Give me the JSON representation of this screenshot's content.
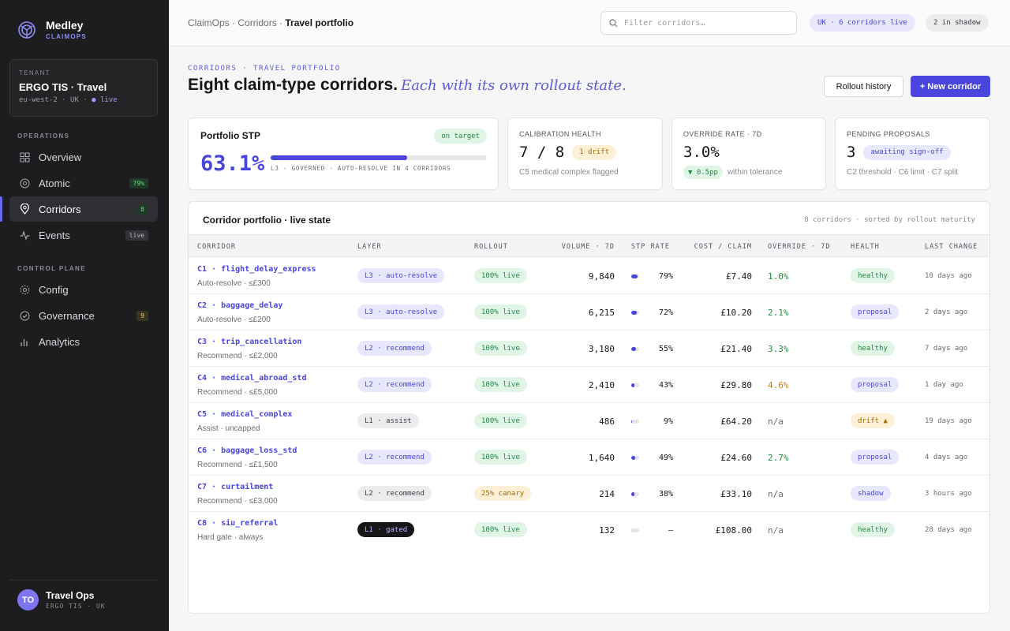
{
  "brand": {
    "name": "Medley",
    "sub": "CLAIMOPS"
  },
  "tenant": {
    "label": "TENANT",
    "name": "ERGO TIS · Travel",
    "meta_region": "eu-west-2 · UK ·",
    "meta_status": "● live"
  },
  "nav": {
    "section_ops": "OPERATIONS",
    "section_cp": "CONTROL PLANE",
    "items": [
      {
        "label": "Overview",
        "icon": "grid-icon"
      },
      {
        "label": "Atomic",
        "icon": "target-icon",
        "badge": "79%"
      },
      {
        "label": "Corridors",
        "icon": "pin-icon",
        "badge": "8"
      },
      {
        "label": "Events",
        "icon": "pulse-icon",
        "badge": "live"
      },
      {
        "label": "Config",
        "icon": "gear-icon"
      },
      {
        "label": "Governance",
        "icon": "check-circle-icon",
        "badge": "9"
      },
      {
        "label": "Analytics",
        "icon": "bar-chart-icon"
      }
    ]
  },
  "user": {
    "initials": "TO",
    "name": "Travel Ops",
    "sub": "ERGO TIS · UK"
  },
  "topbar": {
    "crumb1": "ClaimOps",
    "crumb2": "Corridors",
    "crumb_current": "Travel portfolio",
    "search_placeholder": "Filter corridors…",
    "pill_live": "UK · 6 corridors live",
    "pill_shadow": "2 in shadow"
  },
  "header": {
    "eyebrow": "CORRIDORS · TRAVEL PORTFOLIO",
    "title": "Eight claim-type corridors.",
    "title_italic": "Each with its own rollout state.",
    "btn_history": "Rollout history",
    "btn_new": "+ New corridor"
  },
  "kpi": {
    "stp": {
      "title": "Portfolio STP",
      "value": "63.1%",
      "tag": "on target",
      "progress": 0.631,
      "caption": "L3 · GOVERNED · AUTO-RESOLVE IN 4 CORRIDORS"
    },
    "calibration": {
      "title": "CALIBRATION HEALTH",
      "value": "7 / 8",
      "tag": "1 drift",
      "sub": "C5 medical complex flagged"
    },
    "override": {
      "title": "OVERRIDE RATE · 7D",
      "value": "3.0%",
      "tag": "▼ 0.5pp",
      "sub": "within tolerance"
    },
    "pending": {
      "title": "PENDING PROPOSALS",
      "value": "3",
      "tag": "awaiting sign-off",
      "sub": "C2 threshold · C6 limit · C7 split"
    }
  },
  "table": {
    "title": "Corridor portfolio · live state",
    "meta": "8 corridors · sorted by rollout maturity",
    "columns": [
      "CORRIDOR",
      "LAYER",
      "ROLLOUT",
      "VOLUME · 7D",
      "STP RATE",
      "COST / CLAIM",
      "OVERRIDE · 7D",
      "HEALTH",
      "LAST CHANGE"
    ],
    "rows": [
      {
        "name": "C1 · flight_delay_express",
        "desc": "Auto-resolve · ≤£300",
        "layer": "L3 · auto-resolve",
        "layer_cls": "t-l3",
        "rollout": "100% live",
        "rollout_cls": "t-live",
        "volume": "9,840",
        "stp": "79%",
        "stp_val": 0.79,
        "cost": "£7.40",
        "override": "1.0%",
        "ovr_cls": "o-good",
        "health": "healthy",
        "health_cls": "t-healthy",
        "last": "10 days ago"
      },
      {
        "name": "C2 · baggage_delay",
        "desc": "Auto-resolve · ≤£200",
        "layer": "L3 · auto-resolve",
        "layer_cls": "t-l3",
        "rollout": "100% live",
        "rollout_cls": "t-live",
        "volume": "6,215",
        "stp": "72%",
        "stp_val": 0.72,
        "cost": "£10.20",
        "override": "2.1%",
        "ovr_cls": "o-good",
        "health": "proposal",
        "health_cls": "t-proposal",
        "last": "2 days ago"
      },
      {
        "name": "C3 · trip_cancellation",
        "desc": "Recommend · ≤£2,000",
        "layer": "L2 · recommend",
        "layer_cls": "t-l2",
        "rollout": "100% live",
        "rollout_cls": "t-live",
        "volume": "3,180",
        "stp": "55%",
        "stp_val": 0.55,
        "cost": "£21.40",
        "override": "3.3%",
        "ovr_cls": "o-good",
        "health": "healthy",
        "health_cls": "t-healthy",
        "last": "7 days ago"
      },
      {
        "name": "C4 · medical_abroad_std",
        "desc": "Recommend · ≤£5,000",
        "layer": "L2 · recommend",
        "layer_cls": "t-l2",
        "rollout": "100% live",
        "rollout_cls": "t-live",
        "volume": "2,410",
        "stp": "43%",
        "stp_val": 0.43,
        "cost": "£29.80",
        "override": "4.6%",
        "ovr_cls": "o-warn",
        "health": "proposal",
        "health_cls": "t-proposal",
        "last": "1 day ago"
      },
      {
        "name": "C5 · medical_complex",
        "desc": "Assist · uncapped",
        "layer": "L1 · assist",
        "layer_cls": "t-l1",
        "rollout": "100% live",
        "rollout_cls": "t-live",
        "volume": "486",
        "stp": "9%",
        "stp_val": 0.09,
        "cost": "£64.20",
        "override": "n/a",
        "ovr_cls": "o-na",
        "health": "drift ▲",
        "health_cls": "t-drift",
        "last": "19 days ago"
      },
      {
        "name": "C6 · baggage_loss_std",
        "desc": "Recommend · ≤£1,500",
        "layer": "L2 · recommend",
        "layer_cls": "t-l2",
        "rollout": "100% live",
        "rollout_cls": "t-live",
        "volume": "1,640",
        "stp": "49%",
        "stp_val": 0.49,
        "cost": "£24.60",
        "override": "2.7%",
        "ovr_cls": "o-good",
        "health": "proposal",
        "health_cls": "t-proposal",
        "last": "4 days ago"
      },
      {
        "name": "C7 · curtailment",
        "desc": "Recommend · ≤£3,000",
        "layer": "L2 · recommend",
        "layer_cls": "t-l1",
        "rollout": "25% canary",
        "rollout_cls": "t-canary",
        "volume": "214",
        "stp": "38%",
        "stp_val": 0.38,
        "cost": "£33.10",
        "override": "n/a",
        "ovr_cls": "o-na",
        "health": "shadow",
        "health_cls": "t-shadow",
        "last": "3 hours ago"
      },
      {
        "name": "C8 · siu_referral",
        "desc": "Hard gate · always",
        "layer": "L1 · gated",
        "layer_cls": "t-l1g",
        "rollout": "100% live",
        "rollout_cls": "t-live",
        "volume": "132",
        "stp": "–",
        "stp_val": 0,
        "cost": "£108.00",
        "override": "n/a",
        "ovr_cls": "o-na",
        "health": "healthy",
        "health_cls": "t-healthy",
        "last": "28 days ago"
      }
    ]
  }
}
